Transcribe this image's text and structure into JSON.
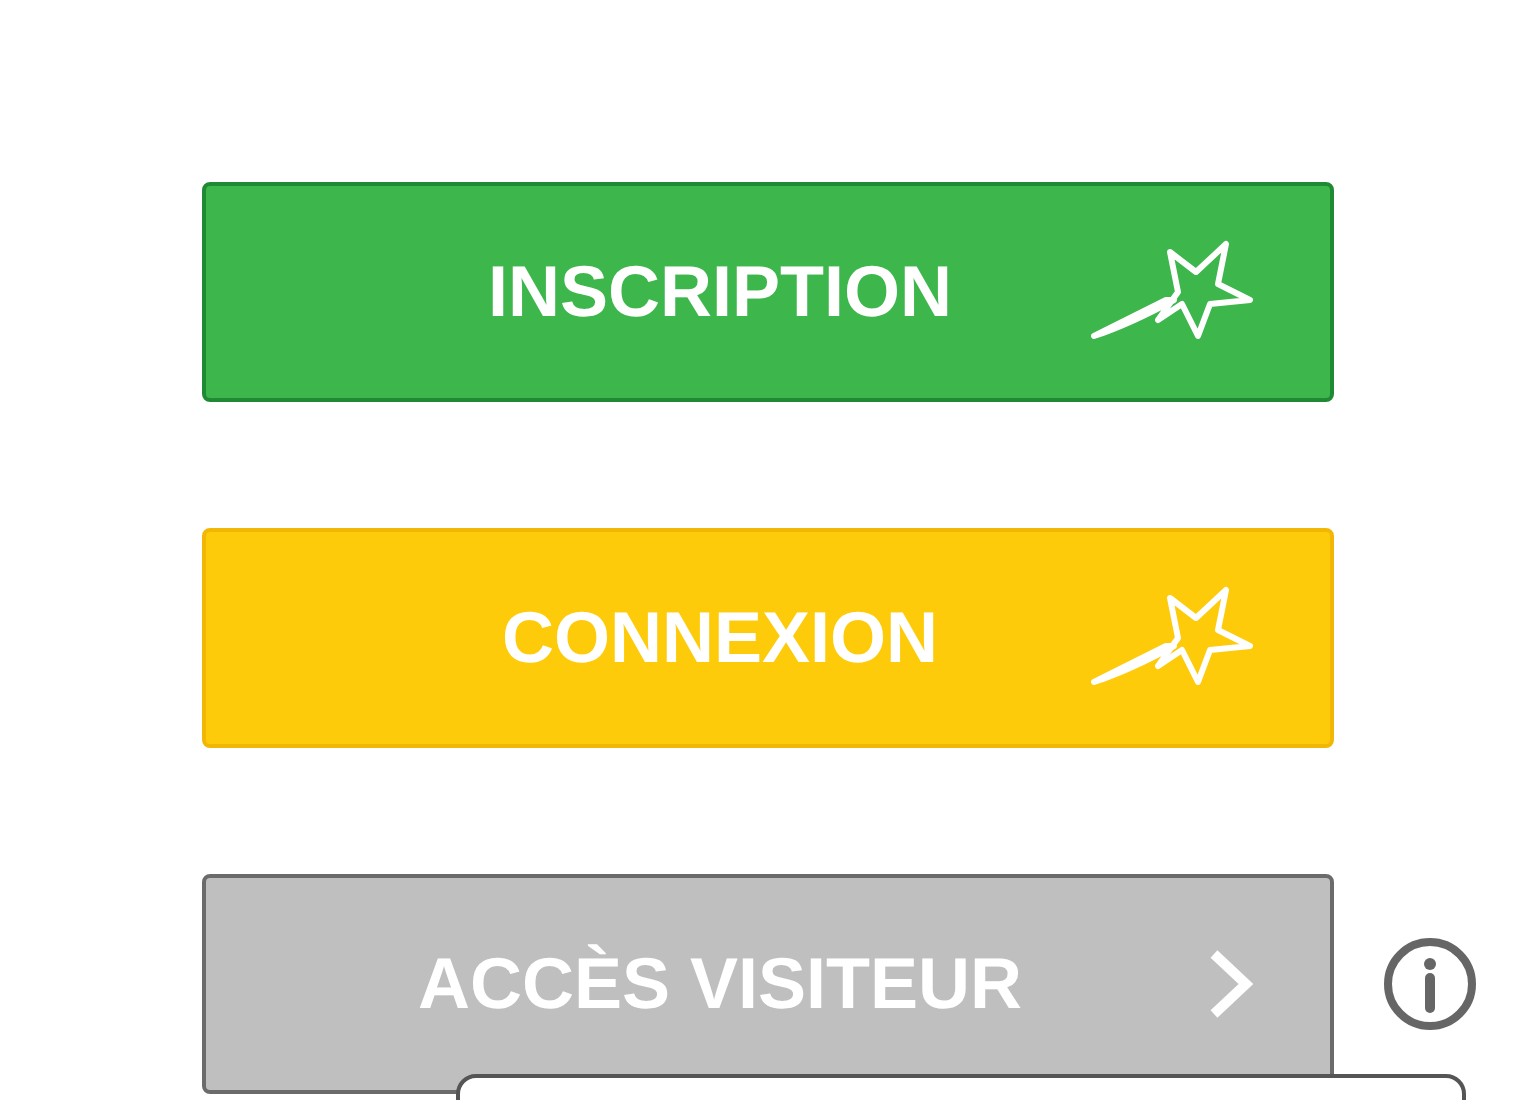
{
  "buttons": [
    {
      "label": "INSCRIPTION",
      "kind": "green"
    },
    {
      "label": "CONNEXION",
      "kind": "yellow"
    },
    {
      "label": "ACCÈS VISITEUR",
      "kind": "grey"
    }
  ],
  "info": {
    "kind": "info"
  },
  "popover": {
    "kind": "panel"
  }
}
